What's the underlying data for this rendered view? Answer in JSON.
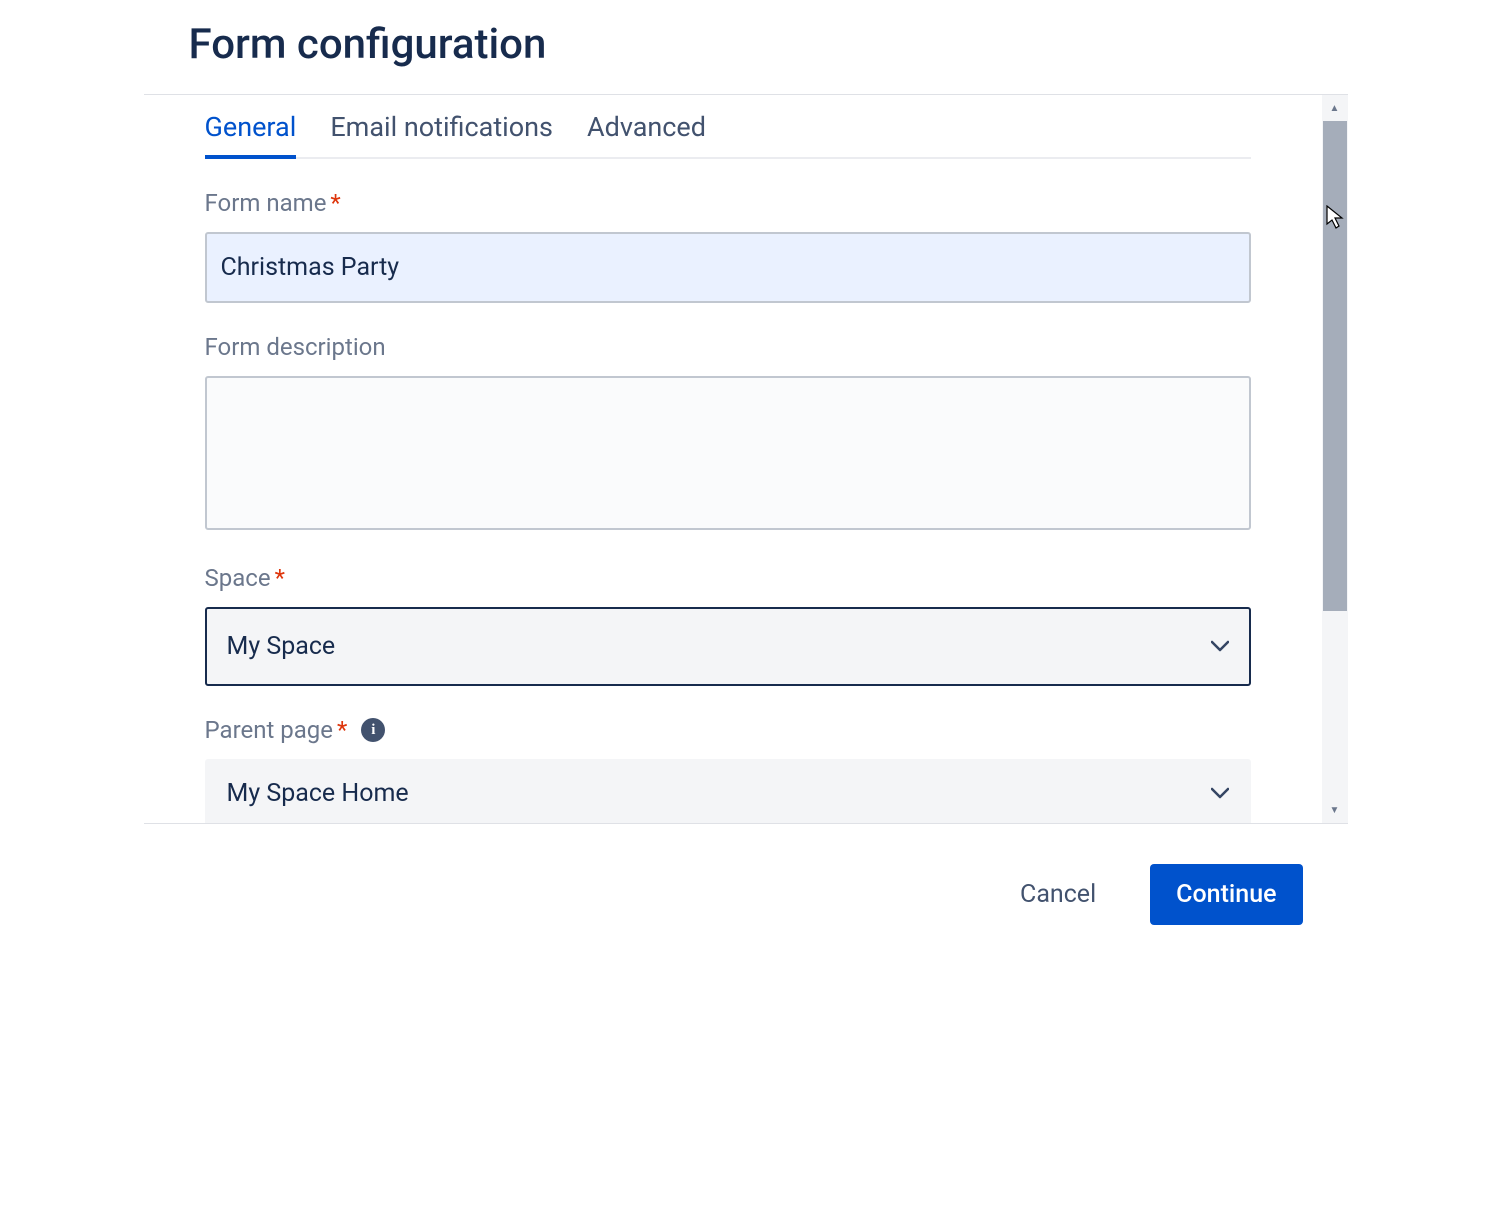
{
  "header": {
    "title": "Form configuration"
  },
  "tabs": {
    "general": "General",
    "email": "Email notifications",
    "advanced": "Advanced"
  },
  "fields": {
    "formName": {
      "label": "Form name",
      "value": "Christmas Party"
    },
    "formDesc": {
      "label": "Form description",
      "value": ""
    },
    "space": {
      "label": "Space",
      "value": "My Space"
    },
    "parent": {
      "label": "Parent page",
      "value": "My Space Home"
    }
  },
  "footer": {
    "cancel": "Cancel",
    "continue": "Continue"
  }
}
